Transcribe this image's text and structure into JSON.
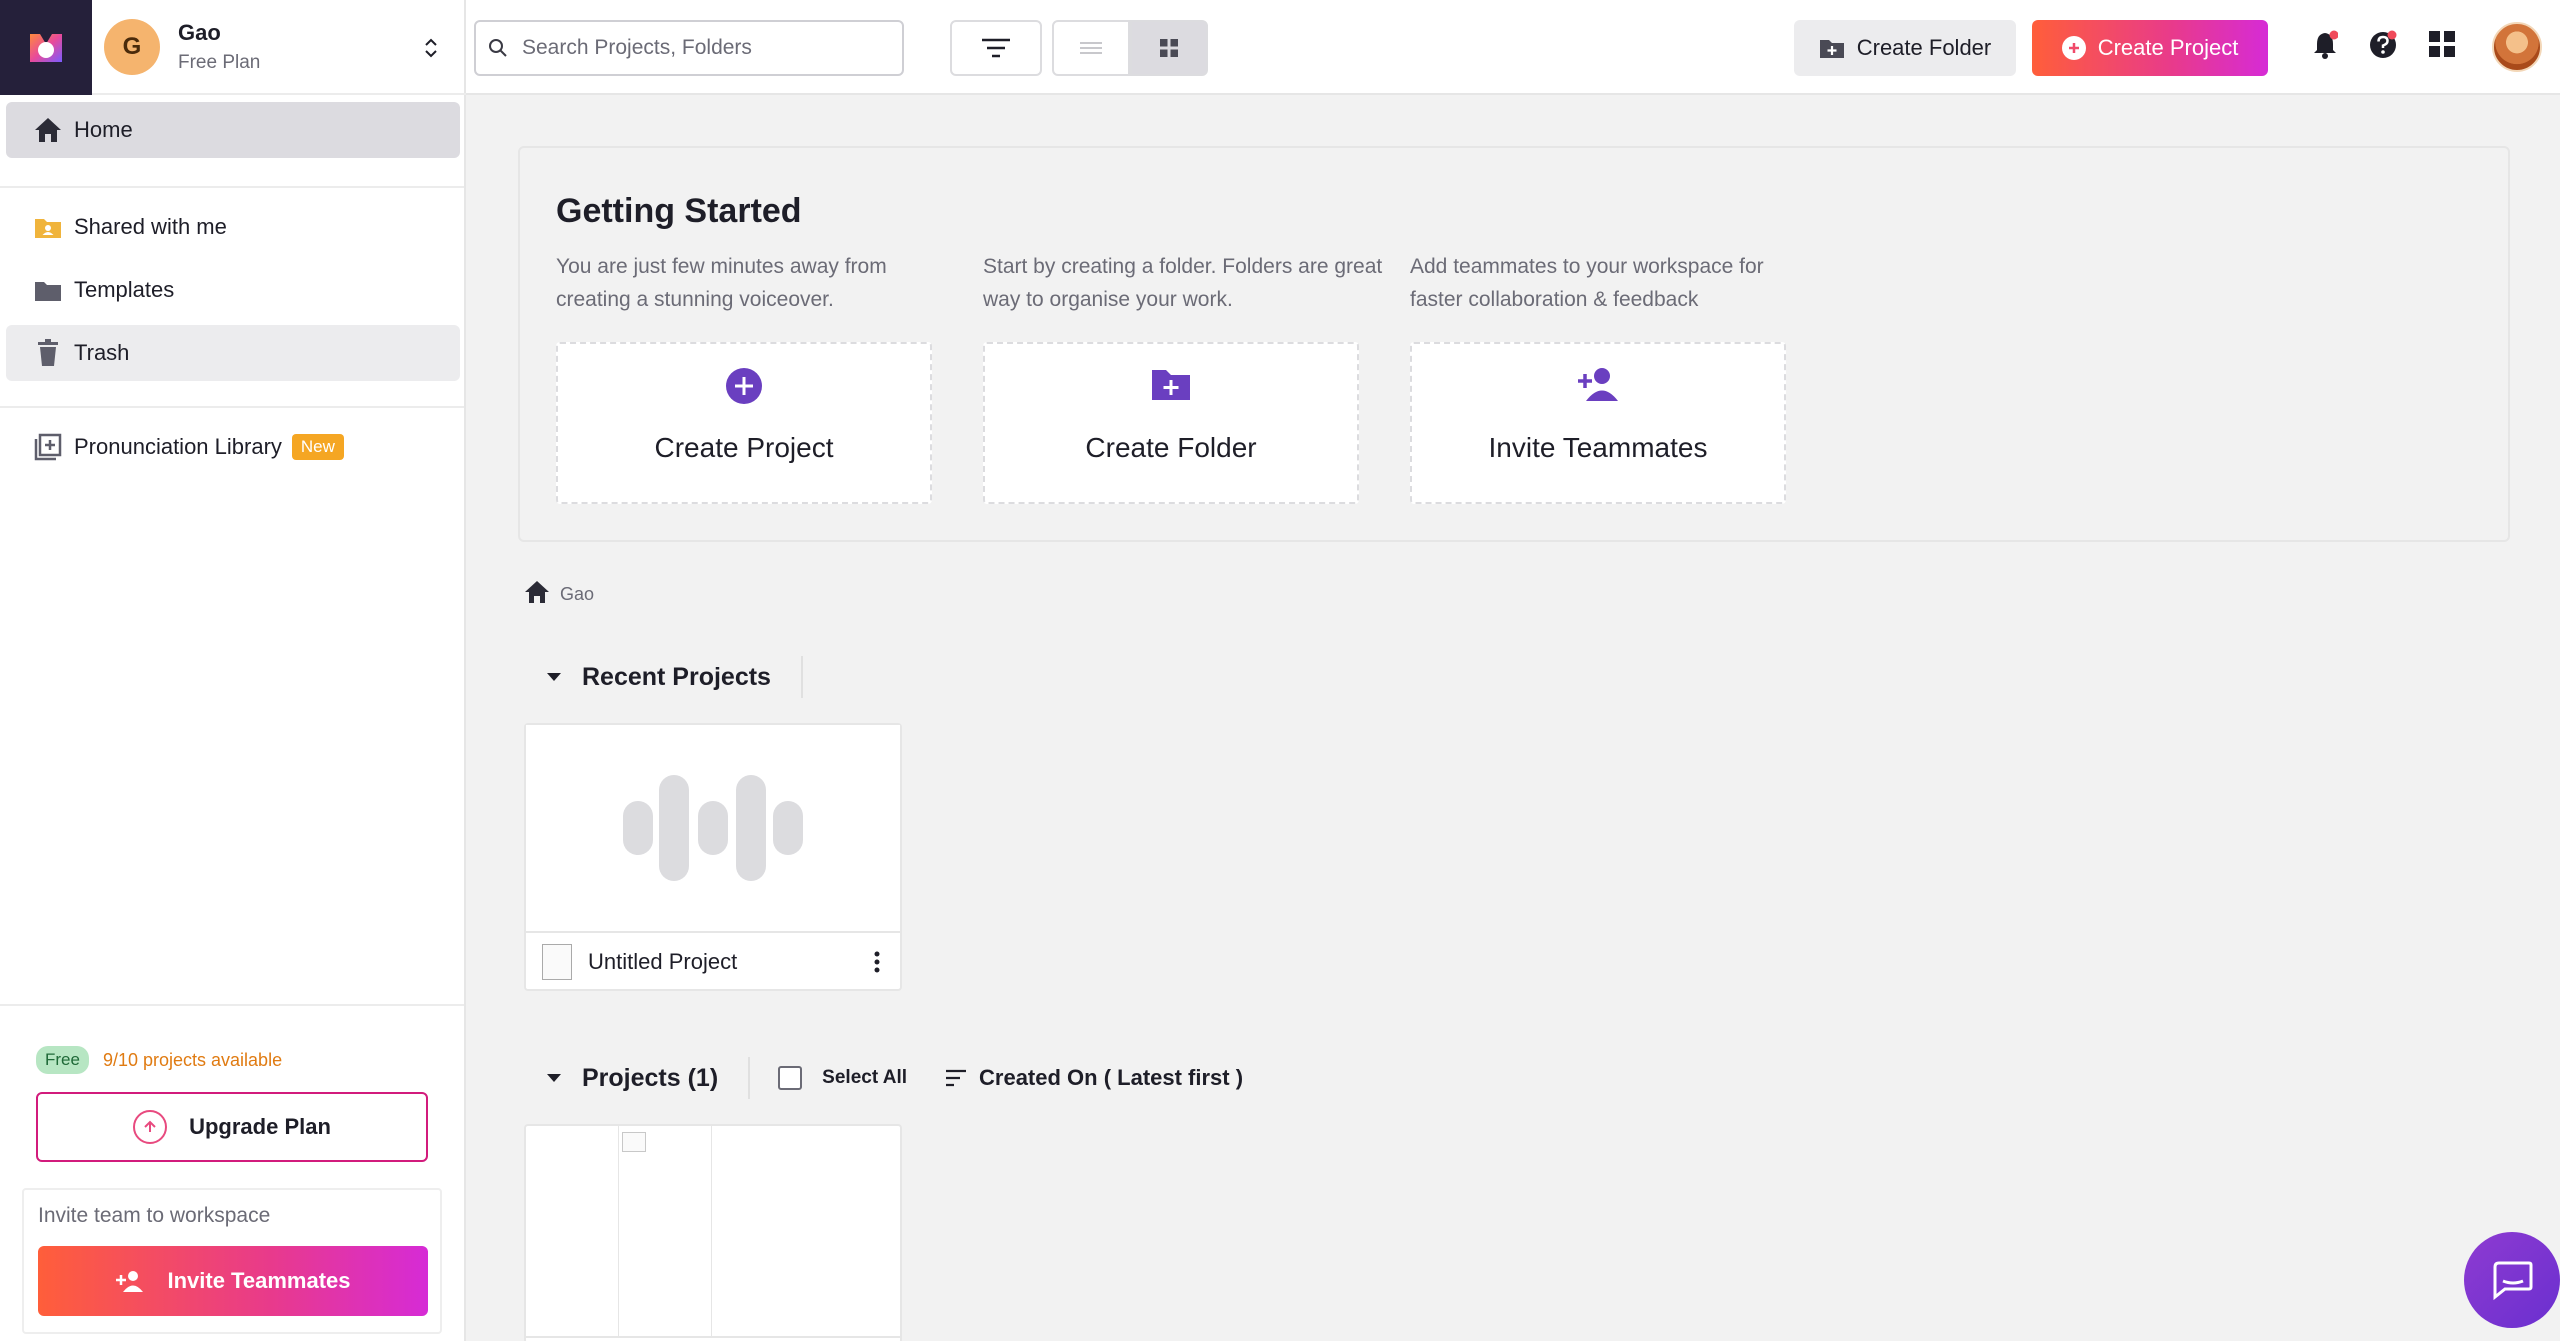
{
  "workspace": {
    "initial": "G",
    "name": "Gao",
    "plan": "Free Plan"
  },
  "sidebar": {
    "items": [
      {
        "label": "Home",
        "icon": "home-icon"
      },
      {
        "label": "Shared with me",
        "icon": "shared-folder-icon"
      },
      {
        "label": "Templates",
        "icon": "folder-icon"
      },
      {
        "label": "Trash",
        "icon": "trash-icon"
      },
      {
        "label": "Pronunciation Library",
        "icon": "library-icon",
        "badge": "New"
      }
    ],
    "plan_badge": "Free",
    "projects_available": "9/10 projects available",
    "upgrade_label": "Upgrade Plan",
    "invite_prompt": "Invite team to workspace",
    "invite_button": "Invite Teammates"
  },
  "topbar": {
    "search_placeholder": "Search Projects, Folders",
    "create_folder": "Create Folder",
    "create_project": "Create Project"
  },
  "getting_started": {
    "title": "Getting Started",
    "cards": [
      {
        "desc": "You are just few minutes away from creating a stunning voiceover.",
        "label": "Create Project",
        "icon": "plus-circle-icon"
      },
      {
        "desc": "Start by creating a folder. Folders are great way to organise your work.",
        "label": "Create Folder",
        "icon": "folder-plus-icon"
      },
      {
        "desc": "Add teammates to your workspace for faster collaboration & feedback",
        "label": "Invite Teammates",
        "icon": "person-add-icon"
      }
    ]
  },
  "breadcrumb": {
    "label": "Gao"
  },
  "recent": {
    "title": "Recent Projects",
    "projects": [
      {
        "name": "Untitled Project"
      }
    ]
  },
  "projects": {
    "title": "Projects (1)",
    "select_all": "Select All",
    "sort_label": "Created On ( Latest first )"
  },
  "colors": {
    "brand_gradient_start": "#ff5e3a",
    "brand_gradient_end": "#d62bd6",
    "accent_purple": "#6a3fc0",
    "free_badge": "#b7e6c3",
    "new_badge": "#f5a623"
  }
}
